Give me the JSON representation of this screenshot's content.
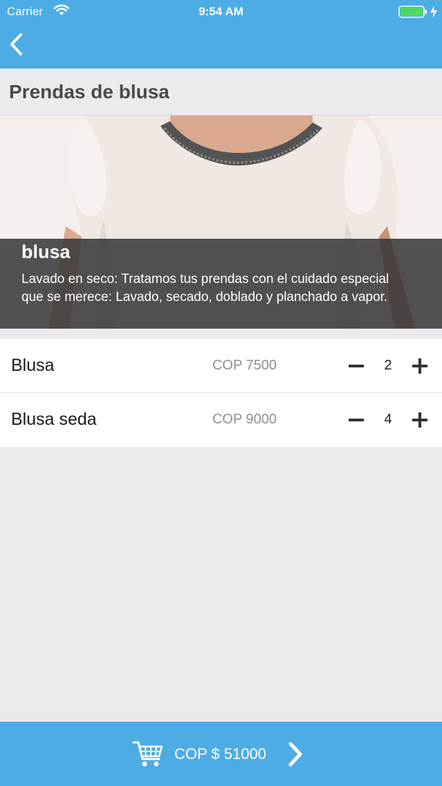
{
  "status_bar": {
    "carrier": "Carrier",
    "time": "9:54 AM"
  },
  "nav": {
    "back_icon": "chevron-left-icon"
  },
  "section": {
    "title": "Prendas de blusa"
  },
  "hero": {
    "name": "blusa",
    "description": "Lavado en seco: Tratamos tus prendas con el cuidado especial que se merece: Lavado, secado, doblado y planchado a vapor."
  },
  "items": [
    {
      "name": "Blusa",
      "price": "COP 7500",
      "quantity": "2"
    },
    {
      "name": "Blusa seda",
      "price": "COP 9000",
      "quantity": "4"
    }
  ],
  "footer": {
    "total": "COP $ 51000",
    "cart_icon": "shopping-cart-icon",
    "next_icon": "chevron-right-icon"
  },
  "colors": {
    "primary": "#4eace4",
    "background": "#ebeaef",
    "overlay": "#373737",
    "battery": "#4cd964"
  }
}
